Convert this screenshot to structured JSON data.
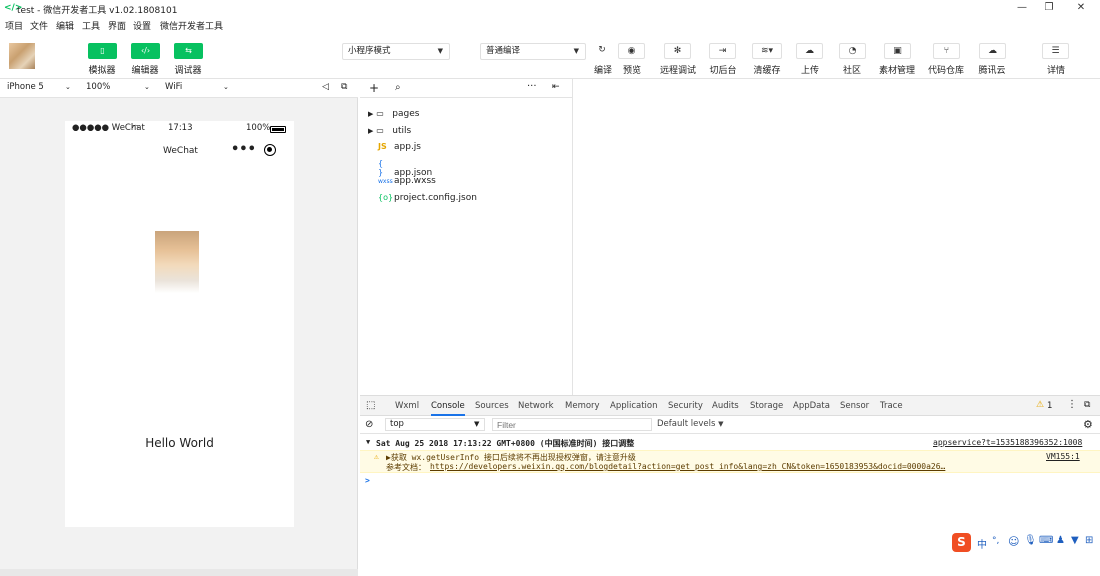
{
  "titlebar": {
    "icon": "</>",
    "title": "test - 微信开发者工具 v1.02.1808101",
    "buttons": [
      "minimize-icon",
      "restore-icon",
      "close-icon"
    ]
  },
  "menu": [
    "项目",
    "文件",
    "编辑",
    "工具",
    "界面",
    "设置",
    "微信开发者工具"
  ],
  "toolbar": {
    "left_buttons": [
      {
        "label": "模拟器",
        "icon": "phone-icon"
      },
      {
        "label": "编辑器",
        "icon": "code-icon"
      },
      {
        "label": "调试器",
        "icon": "swap-icon"
      }
    ],
    "mode_select": "小程序模式",
    "compile_select": "普通编译",
    "right_buttons": [
      {
        "label": "编译",
        "icon": "refresh-icon"
      },
      {
        "label": "预览",
        "icon": "eye-icon"
      },
      {
        "label": "远程调试",
        "icon": "bug-icon"
      },
      {
        "label": "切后台",
        "icon": "background-icon"
      },
      {
        "label": "清缓存",
        "icon": "layers-icon"
      },
      {
        "label": "上传",
        "icon": "cloud-upload-icon"
      },
      {
        "label": "社区",
        "icon": "community-icon"
      },
      {
        "label": "素材管理",
        "icon": "media-icon"
      },
      {
        "label": "代码仓库",
        "icon": "git-icon"
      },
      {
        "label": "腾讯云",
        "icon": "cloud-icon"
      },
      {
        "label": "详情",
        "icon": "menu-icon"
      }
    ]
  },
  "simulator": {
    "device": "iPhone 5",
    "zoom": "100%",
    "network": "WiFi",
    "status": {
      "carrier": "●●●●● WeChat",
      "time": "17:13",
      "battery": "100%"
    },
    "nav_title": "WeChat",
    "content": "Hello World"
  },
  "tree": {
    "items": [
      {
        "name": "pages",
        "type": "folder"
      },
      {
        "name": "utils",
        "type": "folder"
      },
      {
        "name": "app.js",
        "type": "js",
        "icon": "JS"
      },
      {
        "name": "app.json",
        "type": "json",
        "icon": "{ }"
      },
      {
        "name": "app.wxss",
        "type": "wxss",
        "icon": "wxss"
      },
      {
        "name": "project.config.json",
        "type": "json",
        "icon": "{o}"
      }
    ]
  },
  "devtools": {
    "tabs": [
      "Wxml",
      "Console",
      "Sources",
      "Network",
      "Memory",
      "Application",
      "Security",
      "Audits",
      "Storage",
      "AppData",
      "Sensor",
      "Trace"
    ],
    "active_tab": "Console",
    "warning_count": "1",
    "context": "top",
    "filter_placeholder": "Filter",
    "levels": "Default levels",
    "log_header": "Sat Aug 25 2018 17:13:22 GMT+0800 (中国标准时间) 接口调整",
    "log_source": "appservice?t=1535188396352:1008",
    "warn_line1": "▶获取 wx.getUserInfo 接口后续将不再出现授权弹窗，请注意升级",
    "warn_source": "VM155:1",
    "warn_line2_prefix": "参考文档：",
    "warn_link": "https://developers.weixin.qq.com/blogdetail?action=get_post_info&lang=zh_CN&token=1650183953&docid=0000a26…",
    "prompt": ">"
  },
  "ime": {
    "logo": "S",
    "items": [
      "中",
      "°,",
      "☺",
      "🎤",
      "⌨",
      "👤",
      "👕",
      "⊞"
    ]
  },
  "colors": {
    "accent": "#07c160",
    "link": "#1a73e8",
    "warn_bg": "#fffbe5"
  }
}
